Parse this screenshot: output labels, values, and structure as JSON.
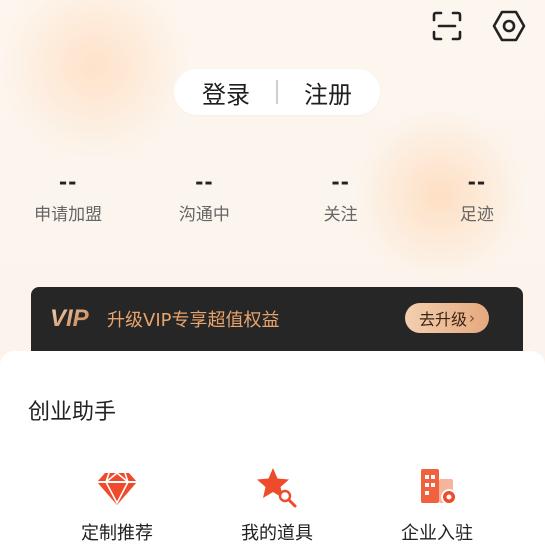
{
  "header": {
    "login_label": "登录",
    "register_label": "注册",
    "scan_icon": "scan-icon",
    "settings_icon": "settings-hexagon-icon"
  },
  "stats": [
    {
      "value": "--",
      "label": "申请加盟"
    },
    {
      "value": "--",
      "label": "沟通中"
    },
    {
      "value": "--",
      "label": "关注"
    },
    {
      "value": "--",
      "label": "足迹"
    }
  ],
  "vip": {
    "logo_text": "VIP",
    "promo_text": "升级VIP专享超值权益",
    "button_label": "去升级",
    "button_arrow": "›",
    "accent": "#e9a36c"
  },
  "assistant": {
    "title": "创业助手",
    "items": [
      {
        "label": "定制推荐",
        "icon": "diamond-icon"
      },
      {
        "label": "我的道具",
        "icon": "star-search-icon"
      },
      {
        "label": "企业入驻",
        "icon": "building-icon"
      }
    ]
  },
  "colors": {
    "brand_red": "#ee4a2c",
    "vip_bg": "#262626"
  }
}
